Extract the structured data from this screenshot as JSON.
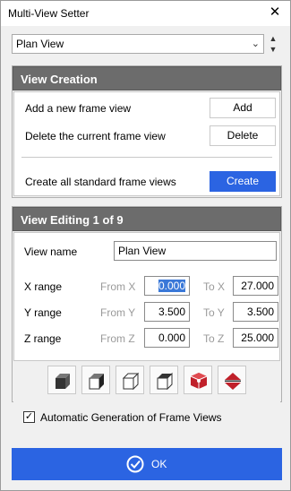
{
  "window": {
    "title": "Multi-View Setter",
    "close_glyph": "✕"
  },
  "view_select": {
    "value": "Plan View",
    "chevron": "⌄",
    "spin_up": "▲",
    "spin_down": "▼"
  },
  "view_creation": {
    "heading": "View Creation",
    "add_label": "Add a new frame view",
    "add_button": "Add",
    "delete_label": "Delete the current frame view",
    "delete_button": "Delete",
    "create_label": "Create all standard frame views",
    "create_button": "Create"
  },
  "view_editing": {
    "heading": "View Editing 1 of 9",
    "name_label": "View name",
    "name_value": "Plan View",
    "x_label": "X range",
    "x_from_label": "From X",
    "x_from": "0.000",
    "x_to_label": "To X",
    "x_to": "27.000",
    "y_label": "Y range",
    "y_from_label": "From Y",
    "y_from": "3.500",
    "y_to_label": "To Y",
    "y_to": "3.500",
    "z_label": "Z range",
    "z_from_label": "From Z",
    "z_from": "0.000",
    "z_to_label": "To Z",
    "z_to": "25.000",
    "tool_icons": [
      "cube-front-dark-icon",
      "cube-right-dark-icon",
      "cube-left-light-icon",
      "cube-back-light-icon",
      "cube-3d-red-icon",
      "flip-vertical-red-icon"
    ]
  },
  "auto_generation": {
    "checked": true,
    "label": "Automatic Generation of Frame Views",
    "check_glyph": "✓"
  },
  "ok_button": {
    "label": "OK"
  },
  "colors": {
    "accent": "#2b64e2",
    "panel_head": "#6c6c6c",
    "selection": "#3a78d8",
    "icon_red": "#c0202a"
  }
}
